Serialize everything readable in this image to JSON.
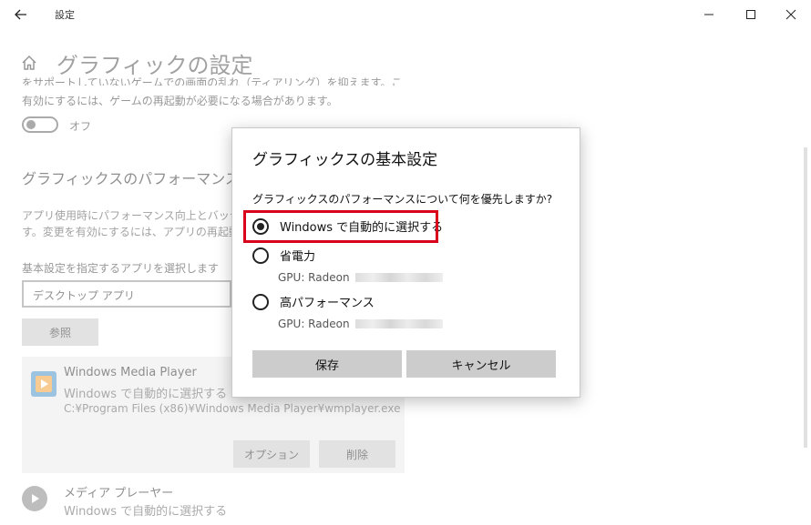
{
  "window": {
    "title": "設定",
    "icons": {
      "back": "back-arrow-icon",
      "minimize": "minimize-icon",
      "maximize": "maximize-icon",
      "close": "close-icon"
    }
  },
  "page": {
    "title": "グラフィックの設定",
    "desc_cut": "をサポートしていないゲームでの画面の乱れ（ティアリング）を抑えます。この処理を",
    "desc_line2": "有効にするには、ゲームの再起動が必要になる場合があります。",
    "toggle_label": "オフ",
    "section_title": "グラフィックスのパフォーマンスの基",
    "section_desc1": "アプリ使用時にパフォーマンス向上とバッテリー",
    "section_desc2": "す。変更を有効にするには、アプリの再起動が",
    "select_label": "基本設定を指定するアプリを選択します",
    "dropdown_value": "デスクトップ アプリ",
    "browse_label": "参照",
    "apps": [
      {
        "name": "Windows Media Player",
        "setting": "Windows で自動的に選択する",
        "path": "C:¥Program Files (x86)¥Windows Media Player¥wmplayer.exe",
        "options_label": "オプション",
        "delete_label": "削除"
      },
      {
        "name": "メディア プレーヤー",
        "setting": "Windows で自動的に選択する"
      }
    ]
  },
  "dialog": {
    "title": "グラフィックスの基本設定",
    "question": "グラフィックスのパフォーマンスについて何を優先しますか?",
    "options": [
      {
        "label": "Windows で自動的に選択する",
        "checked": true
      },
      {
        "label": "省電力",
        "gpu": "GPU: Radeon",
        "checked": false
      },
      {
        "label": "高パフォーマンス",
        "gpu": "GPU: Radeon",
        "checked": false
      }
    ],
    "save_label": "保存",
    "cancel_label": "キャンセル",
    "highlight_color": "#d9001b"
  }
}
